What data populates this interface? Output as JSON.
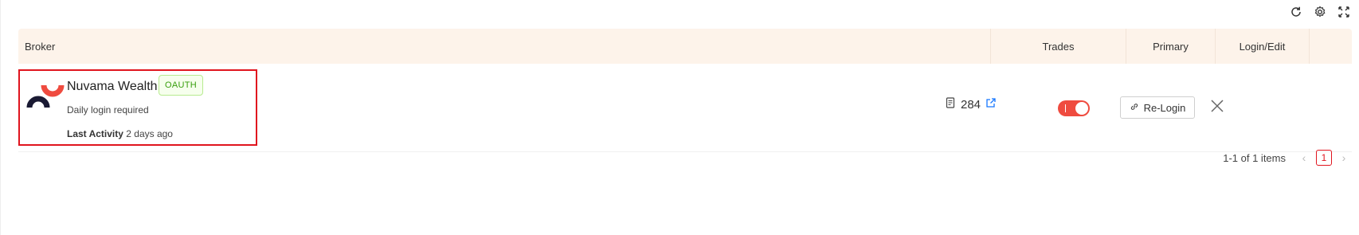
{
  "toolbar": {
    "refresh_icon": "refresh-icon",
    "settings_icon": "gear-icon",
    "fullscreen_icon": "fullscreen-icon"
  },
  "table": {
    "headers": {
      "broker": "Broker",
      "trades": "Trades",
      "primary": "Primary",
      "login_edit": "Login/Edit"
    },
    "rows": [
      {
        "broker_name": "Nuvama Wealth",
        "auth_type": "OAUTH",
        "subtitle": "Daily login required",
        "last_activity_label": "Last Activity",
        "last_activity_value": "2 days ago",
        "trades_count": "284",
        "primary_enabled": true,
        "relogin_label": "Re-Login"
      }
    ]
  },
  "pagination": {
    "summary": "1-1 of 1 items",
    "current_page": "1",
    "prev": "‹",
    "next": "›"
  },
  "colors": {
    "header_bg": "#fdf3ea",
    "accent": "#ef4b3f",
    "highlight_border": "#e0141e",
    "badge_green": "#389e0d",
    "link_blue": "#1677ff"
  }
}
